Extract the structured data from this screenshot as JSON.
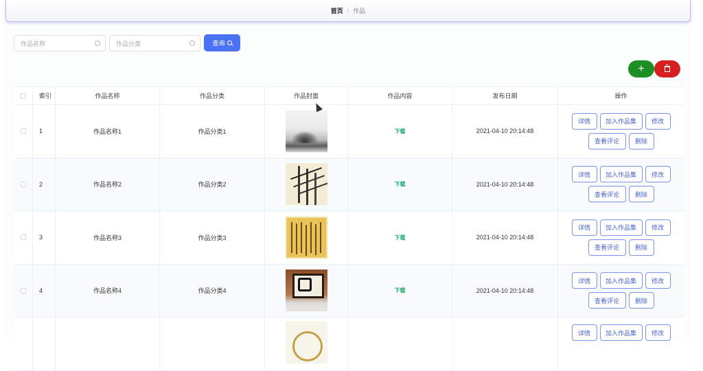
{
  "breadcrumb": {
    "home": "首页",
    "separator": "/",
    "current": "作品"
  },
  "search": {
    "name_placeholder": "作品名称",
    "category_placeholder": "作品分类",
    "query_label": "查询"
  },
  "table": {
    "headers": [
      "",
      "索引",
      "作品名称",
      "作品分类",
      "作品封面",
      "作品内容",
      "发布日期",
      "操作"
    ],
    "rows": [
      {
        "index": "1",
        "name": "作品名称1",
        "category": "作品分类1",
        "content": "下载",
        "date": "2021-04-10 20:14:48",
        "cover": "ink-landscape"
      },
      {
        "index": "2",
        "name": "作品名称2",
        "category": "作品分类2",
        "content": "下载",
        "date": "2021-04-10 20:14:48",
        "cover": "bamboo-painting"
      },
      {
        "index": "3",
        "name": "作品名称3",
        "category": "作品分类3",
        "content": "下载",
        "date": "2021-04-10 20:14:48",
        "cover": "calligraphy-scroll"
      },
      {
        "index": "4",
        "name": "作品名称4",
        "category": "作品分类4",
        "content": "下载",
        "date": "2021-04-10 20:14:48",
        "cover": "framed-calligraphy"
      },
      {
        "index": "",
        "name": "",
        "category": "",
        "content": "",
        "date": "",
        "cover": "round-calligraphy"
      }
    ],
    "actions": {
      "detail": "详情",
      "add_collection": "加入作品集",
      "edit": "修改",
      "view_comments": "查看评论",
      "delete": "删除"
    }
  },
  "colors": {
    "primary": "#4a72f5",
    "add": "#1e8f24",
    "delete": "#d61f1f",
    "download": "#1aa86d"
  }
}
